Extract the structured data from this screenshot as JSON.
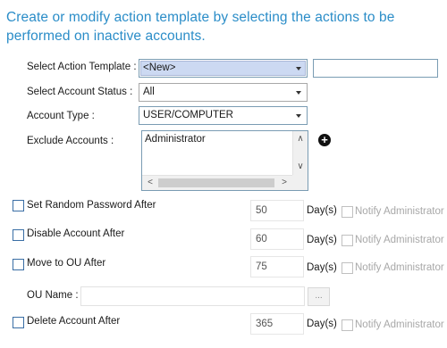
{
  "header": {
    "title": "Create or modify action template by selecting the actions to be performed on inactive accounts."
  },
  "form": {
    "action_template_label": "Select Action Template :",
    "action_template_value": "<New>",
    "account_status_label": "Select Account Status :",
    "account_status_value": "All",
    "account_type_label": "Account Type :",
    "account_type_value": "USER/COMPUTER",
    "exclude_label": "Exclude Accounts :",
    "exclude_items": [
      "Administrator"
    ]
  },
  "scroll_glyphs": {
    "up": "∧",
    "down": "∨",
    "left": "<",
    "right": ">"
  },
  "add_glyph": "+",
  "actions": [
    {
      "label": "Set Random Password After",
      "value": "50",
      "unit": "Day(s)",
      "notify": "Notify Administrator"
    },
    {
      "label": "Disable Account After",
      "value": "60",
      "unit": "Day(s)",
      "notify": "Notify Administrator"
    },
    {
      "label": "Move to OU After",
      "value": "75",
      "unit": "Day(s)",
      "notify": "Notify Administrator"
    },
    {
      "label": "Delete Account After",
      "value": "365",
      "unit": "Day(s)",
      "notify": "Notify Administrator"
    }
  ],
  "ou": {
    "label": "OU Name :",
    "browse_label": "..."
  }
}
